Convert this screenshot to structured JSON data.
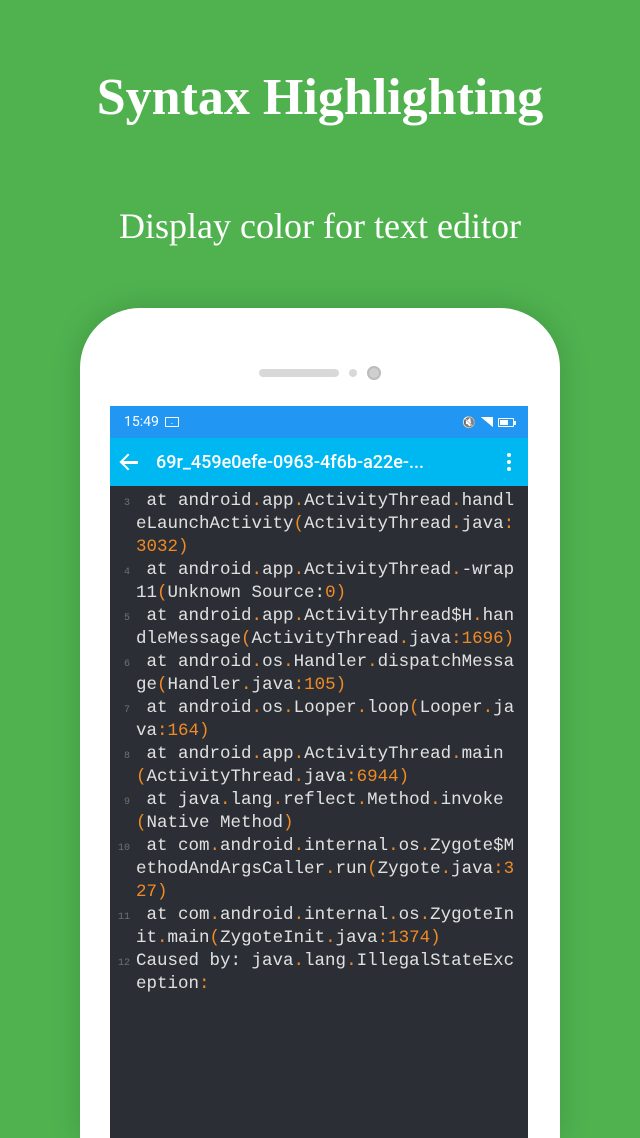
{
  "hero": {
    "title": "Syntax Highlighting",
    "subtitle": "Display color for text editor"
  },
  "status_bar": {
    "time": "15:49"
  },
  "app_bar": {
    "title": "69r_459e0efe-0963-4f6b-a22e-..."
  },
  "code": {
    "lines": [
      {
        "num": "3",
        "tokens": [
          {
            "t": " at android",
            "c": "ident"
          },
          {
            "t": ".",
            "c": "punct"
          },
          {
            "t": "app",
            "c": "ident"
          },
          {
            "t": ".",
            "c": "punct"
          },
          {
            "t": "ActivityThread",
            "c": "ident"
          },
          {
            "t": ".",
            "c": "punct"
          },
          {
            "t": "handleLaunchActivity",
            "c": "ident"
          },
          {
            "t": "(",
            "c": "punct"
          },
          {
            "t": "ActivityThread",
            "c": "ident"
          },
          {
            "t": ".",
            "c": "punct"
          },
          {
            "t": "java",
            "c": "ident"
          },
          {
            "t": ":",
            "c": "punct"
          },
          {
            "t": "3032",
            "c": "num"
          },
          {
            "t": ")",
            "c": "punct"
          }
        ]
      },
      {
        "num": "4",
        "tokens": [
          {
            "t": " at android",
            "c": "ident"
          },
          {
            "t": ".",
            "c": "punct"
          },
          {
            "t": "app",
            "c": "ident"
          },
          {
            "t": ".",
            "c": "punct"
          },
          {
            "t": "ActivityThread",
            "c": "ident"
          },
          {
            "t": ".",
            "c": "punct"
          },
          {
            "t": "-wrap11",
            "c": "ident"
          },
          {
            "t": "(",
            "c": "punct"
          },
          {
            "t": "Unknown Source:",
            "c": "ident"
          },
          {
            "t": "0",
            "c": "num"
          },
          {
            "t": ")",
            "c": "punct"
          }
        ]
      },
      {
        "num": "5",
        "tokens": [
          {
            "t": " at android",
            "c": "ident"
          },
          {
            "t": ".",
            "c": "punct"
          },
          {
            "t": "app",
            "c": "ident"
          },
          {
            "t": ".",
            "c": "punct"
          },
          {
            "t": "ActivityThread$H",
            "c": "ident"
          },
          {
            "t": ".",
            "c": "punct"
          },
          {
            "t": "handleMessage",
            "c": "ident"
          },
          {
            "t": "(",
            "c": "punct"
          },
          {
            "t": "ActivityThread",
            "c": "ident"
          },
          {
            "t": ".",
            "c": "punct"
          },
          {
            "t": "java",
            "c": "ident"
          },
          {
            "t": ":",
            "c": "punct"
          },
          {
            "t": "1696",
            "c": "num"
          },
          {
            "t": ")",
            "c": "punct"
          }
        ]
      },
      {
        "num": "6",
        "tokens": [
          {
            "t": " at android",
            "c": "ident"
          },
          {
            "t": ".",
            "c": "punct"
          },
          {
            "t": "os",
            "c": "ident"
          },
          {
            "t": ".",
            "c": "punct"
          },
          {
            "t": "Handler",
            "c": "ident"
          },
          {
            "t": ".",
            "c": "punct"
          },
          {
            "t": "dispatchMessage",
            "c": "ident"
          },
          {
            "t": "(",
            "c": "punct"
          },
          {
            "t": "Handler",
            "c": "ident"
          },
          {
            "t": ".",
            "c": "punct"
          },
          {
            "t": "java",
            "c": "ident"
          },
          {
            "t": ":",
            "c": "punct"
          },
          {
            "t": "105",
            "c": "num"
          },
          {
            "t": ")",
            "c": "punct"
          }
        ]
      },
      {
        "num": "7",
        "tokens": [
          {
            "t": " at android",
            "c": "ident"
          },
          {
            "t": ".",
            "c": "punct"
          },
          {
            "t": "os",
            "c": "ident"
          },
          {
            "t": ".",
            "c": "punct"
          },
          {
            "t": "Looper",
            "c": "ident"
          },
          {
            "t": ".",
            "c": "punct"
          },
          {
            "t": "loop",
            "c": "ident"
          },
          {
            "t": "(",
            "c": "punct"
          },
          {
            "t": "Looper",
            "c": "ident"
          },
          {
            "t": ".",
            "c": "punct"
          },
          {
            "t": "java",
            "c": "ident"
          },
          {
            "t": ":",
            "c": "punct"
          },
          {
            "t": "164",
            "c": "num"
          },
          {
            "t": ")",
            "c": "punct"
          }
        ]
      },
      {
        "num": "8",
        "tokens": [
          {
            "t": " at android",
            "c": "ident"
          },
          {
            "t": ".",
            "c": "punct"
          },
          {
            "t": "app",
            "c": "ident"
          },
          {
            "t": ".",
            "c": "punct"
          },
          {
            "t": "ActivityThread",
            "c": "ident"
          },
          {
            "t": ".",
            "c": "punct"
          },
          {
            "t": "main",
            "c": "ident"
          },
          {
            "t": "(",
            "c": "punct"
          },
          {
            "t": "ActivityThread",
            "c": "ident"
          },
          {
            "t": ".",
            "c": "punct"
          },
          {
            "t": "java",
            "c": "ident"
          },
          {
            "t": ":",
            "c": "punct"
          },
          {
            "t": "6944",
            "c": "num"
          },
          {
            "t": ")",
            "c": "punct"
          }
        ]
      },
      {
        "num": "9",
        "tokens": [
          {
            "t": " at java",
            "c": "ident"
          },
          {
            "t": ".",
            "c": "punct"
          },
          {
            "t": "lang",
            "c": "ident"
          },
          {
            "t": ".",
            "c": "punct"
          },
          {
            "t": "reflect",
            "c": "ident"
          },
          {
            "t": ".",
            "c": "punct"
          },
          {
            "t": "Method",
            "c": "ident"
          },
          {
            "t": ".",
            "c": "punct"
          },
          {
            "t": "invoke",
            "c": "ident"
          },
          {
            "t": "(",
            "c": "punct"
          },
          {
            "t": "Native Method",
            "c": "ident"
          },
          {
            "t": ")",
            "c": "punct"
          }
        ]
      },
      {
        "num": "10",
        "tokens": [
          {
            "t": " at com",
            "c": "ident"
          },
          {
            "t": ".",
            "c": "punct"
          },
          {
            "t": "android",
            "c": "ident"
          },
          {
            "t": ".",
            "c": "punct"
          },
          {
            "t": "internal",
            "c": "ident"
          },
          {
            "t": ".",
            "c": "punct"
          },
          {
            "t": "os",
            "c": "ident"
          },
          {
            "t": ".",
            "c": "punct"
          },
          {
            "t": "Zygote$MethodAndArgsCaller",
            "c": "ident"
          },
          {
            "t": ".",
            "c": "punct"
          },
          {
            "t": "run",
            "c": "ident"
          },
          {
            "t": "(",
            "c": "punct"
          },
          {
            "t": "Zygote",
            "c": "ident"
          },
          {
            "t": ".",
            "c": "punct"
          },
          {
            "t": "java",
            "c": "ident"
          },
          {
            "t": ":",
            "c": "punct"
          },
          {
            "t": "327",
            "c": "num"
          },
          {
            "t": ")",
            "c": "punct"
          }
        ]
      },
      {
        "num": "11",
        "tokens": [
          {
            "t": " at com",
            "c": "ident"
          },
          {
            "t": ".",
            "c": "punct"
          },
          {
            "t": "android",
            "c": "ident"
          },
          {
            "t": ".",
            "c": "punct"
          },
          {
            "t": "internal",
            "c": "ident"
          },
          {
            "t": ".",
            "c": "punct"
          },
          {
            "t": "os",
            "c": "ident"
          },
          {
            "t": ".",
            "c": "punct"
          },
          {
            "t": "ZygoteInit",
            "c": "ident"
          },
          {
            "t": ".",
            "c": "punct"
          },
          {
            "t": "main",
            "c": "ident"
          },
          {
            "t": "(",
            "c": "punct"
          },
          {
            "t": "ZygoteInit",
            "c": "ident"
          },
          {
            "t": ".",
            "c": "punct"
          },
          {
            "t": "java",
            "c": "ident"
          },
          {
            "t": ":",
            "c": "punct"
          },
          {
            "t": "1374",
            "c": "num"
          },
          {
            "t": ")",
            "c": "punct"
          }
        ]
      },
      {
        "num": "12",
        "tokens": [
          {
            "t": "Caused by: java",
            "c": "ident"
          },
          {
            "t": ".",
            "c": "punct"
          },
          {
            "t": "lang",
            "c": "ident"
          },
          {
            "t": ".",
            "c": "punct"
          },
          {
            "t": "IllegalStateException",
            "c": "ident"
          },
          {
            "t": ":",
            "c": "punct"
          }
        ]
      }
    ]
  }
}
